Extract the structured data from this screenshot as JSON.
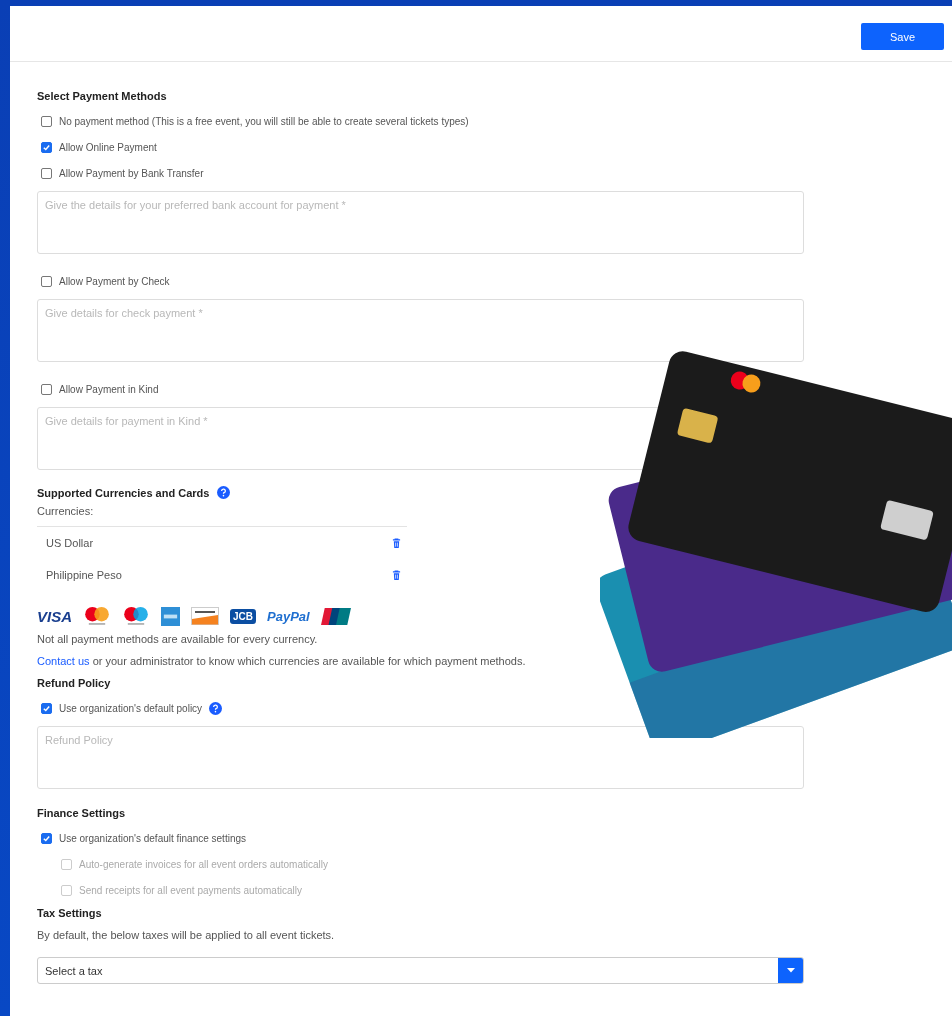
{
  "save_button": "Save",
  "payment_methods": {
    "title": "Select Payment Methods",
    "options": [
      {
        "label": "No payment method (This is a free event, you will still be able to create several tickets types)",
        "checked": false
      },
      {
        "label": "Allow Online Payment",
        "checked": true
      },
      {
        "label": "Allow Payment by Bank Transfer",
        "checked": false,
        "details_placeholder": "Give the details for your preferred bank account for payment *"
      },
      {
        "label": "Allow Payment by Check",
        "checked": false,
        "details_placeholder": "Give details for check payment *"
      },
      {
        "label": "Allow Payment in Kind",
        "checked": false,
        "details_placeholder": "Give details for payment in Kind *"
      }
    ]
  },
  "currencies": {
    "title": "Supported Currencies and Cards",
    "label": "Currencies:",
    "items": [
      {
        "name": "US Dollar"
      },
      {
        "name": "Philippine Peso"
      }
    ]
  },
  "card_logos": [
    {
      "kind": "visa",
      "label": "VISA"
    },
    {
      "kind": "mastercard"
    },
    {
      "kind": "maestro"
    },
    {
      "kind": "amex"
    },
    {
      "kind": "discover"
    },
    {
      "kind": "jcb",
      "label": "JCB"
    },
    {
      "kind": "paypal",
      "label": "PayPal"
    },
    {
      "kind": "unionpay"
    }
  ],
  "notes": {
    "availability": "Not all payment methods are available for every currency.",
    "contact_link": "Contact us",
    "contact_rest": "or your administrator to know which currencies are available for which payment methods."
  },
  "refund": {
    "title": "Refund Policy",
    "use_default": {
      "label": "Use organization's default policy",
      "checked": true
    },
    "placeholder": "Refund Policy"
  },
  "finance": {
    "title": "Finance Settings",
    "use_default": {
      "label": "Use organization's default finance settings",
      "checked": true
    },
    "options": [
      {
        "label": "Auto-generate invoices for all event orders automatically",
        "checked": false,
        "disabled": true
      },
      {
        "label": "Send receipts for all event payments automatically",
        "checked": false,
        "disabled": true
      }
    ]
  },
  "tax": {
    "title": "Tax Settings",
    "description": "By default, the below taxes will be applied to all event tickets.",
    "select_placeholder": "Select a tax"
  }
}
